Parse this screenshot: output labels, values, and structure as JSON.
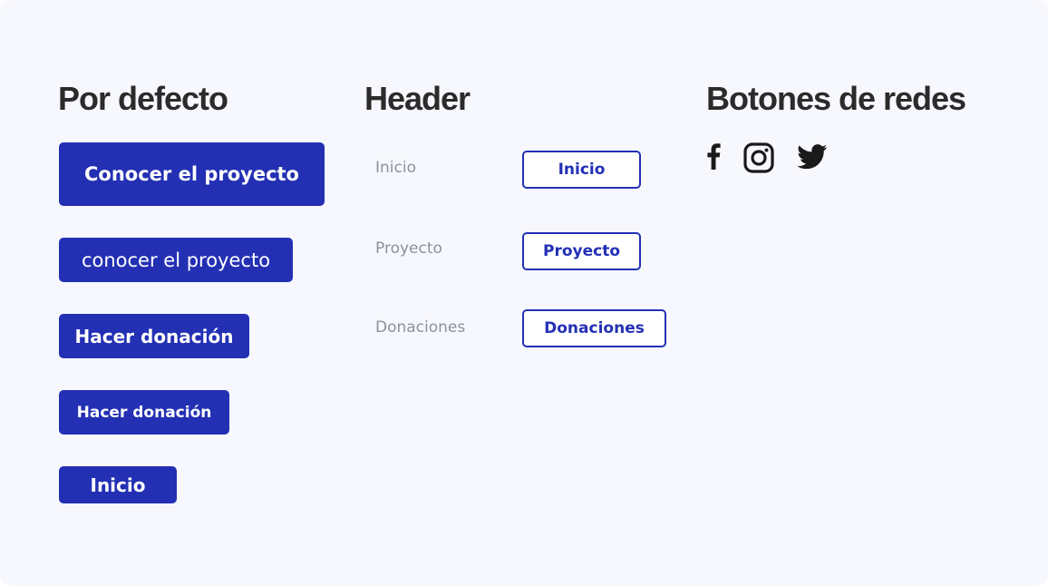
{
  "colors": {
    "primary": "#2330b4",
    "background": "#f7f8fe",
    "heading": "#2b2b2b",
    "muted_text": "#8d919c",
    "icon": "#1a1a1a"
  },
  "default_section": {
    "title": "Por defecto",
    "buttons": [
      "Conocer el proyecto",
      "conocer el proyecto",
      "Hacer donación",
      "Hacer donación",
      "Inicio"
    ]
  },
  "header_section": {
    "title": "Header",
    "text_links": [
      "Inicio",
      "Proyecto",
      "Donaciones"
    ],
    "outlined_buttons": [
      "Inicio",
      "Proyecto",
      "Donaciones"
    ]
  },
  "social_section": {
    "title": "Botones de redes",
    "icons": [
      "facebook-icon",
      "instagram-icon",
      "twitter-icon"
    ]
  }
}
